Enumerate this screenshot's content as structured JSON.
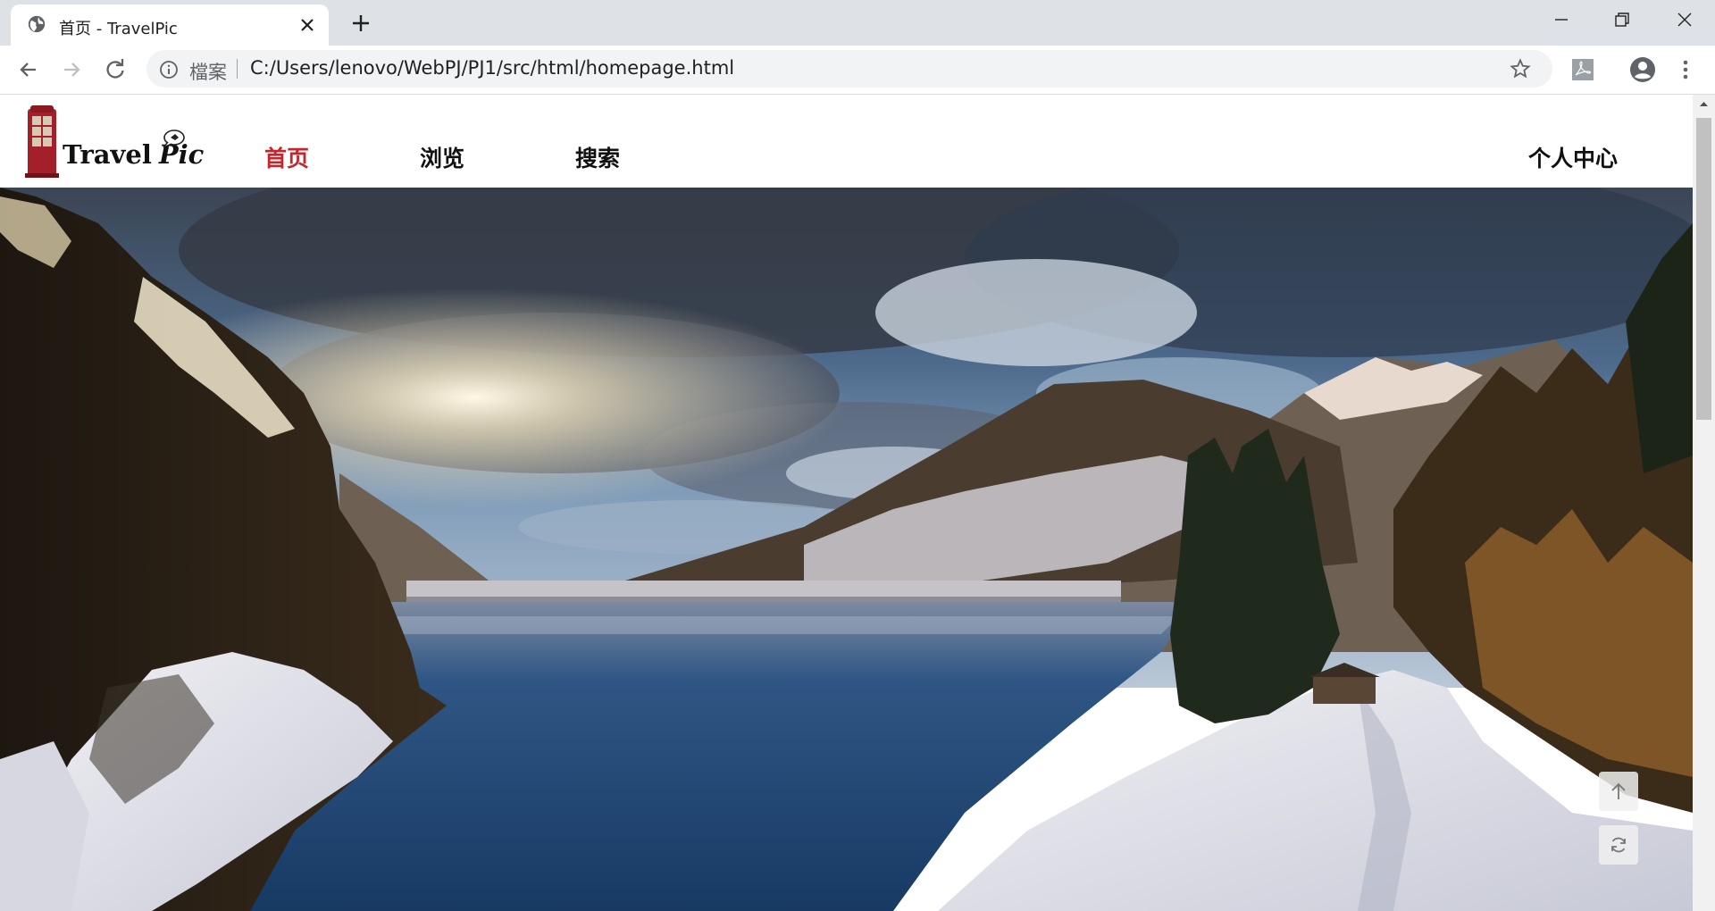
{
  "browser": {
    "tab_title": "首页 - TravelPic",
    "security_label": "檔案",
    "url": "C:/Users/lenovo/WebPJ/PJ1/src/html/homepage.html"
  },
  "site": {
    "logo_text_travel": "Travel",
    "logo_text_pic": "Pic",
    "nav": {
      "home": "首页",
      "browse": "浏览",
      "search": "搜索",
      "profile": "个人中心"
    },
    "active_nav_color": "#c0282e"
  },
  "icons": {
    "tab": "globe-icon",
    "close": "close-icon",
    "new_tab": "plus-icon",
    "back": "arrow-left-icon",
    "forward": "arrow-right-icon",
    "reload": "reload-icon",
    "info": "info-icon",
    "star": "star-icon",
    "pdf": "pdf-extension-icon",
    "profile": "account-icon",
    "menu": "more-vert-icon",
    "back_to_top": "arrow-up-icon",
    "refresh": "refresh-icon"
  }
}
